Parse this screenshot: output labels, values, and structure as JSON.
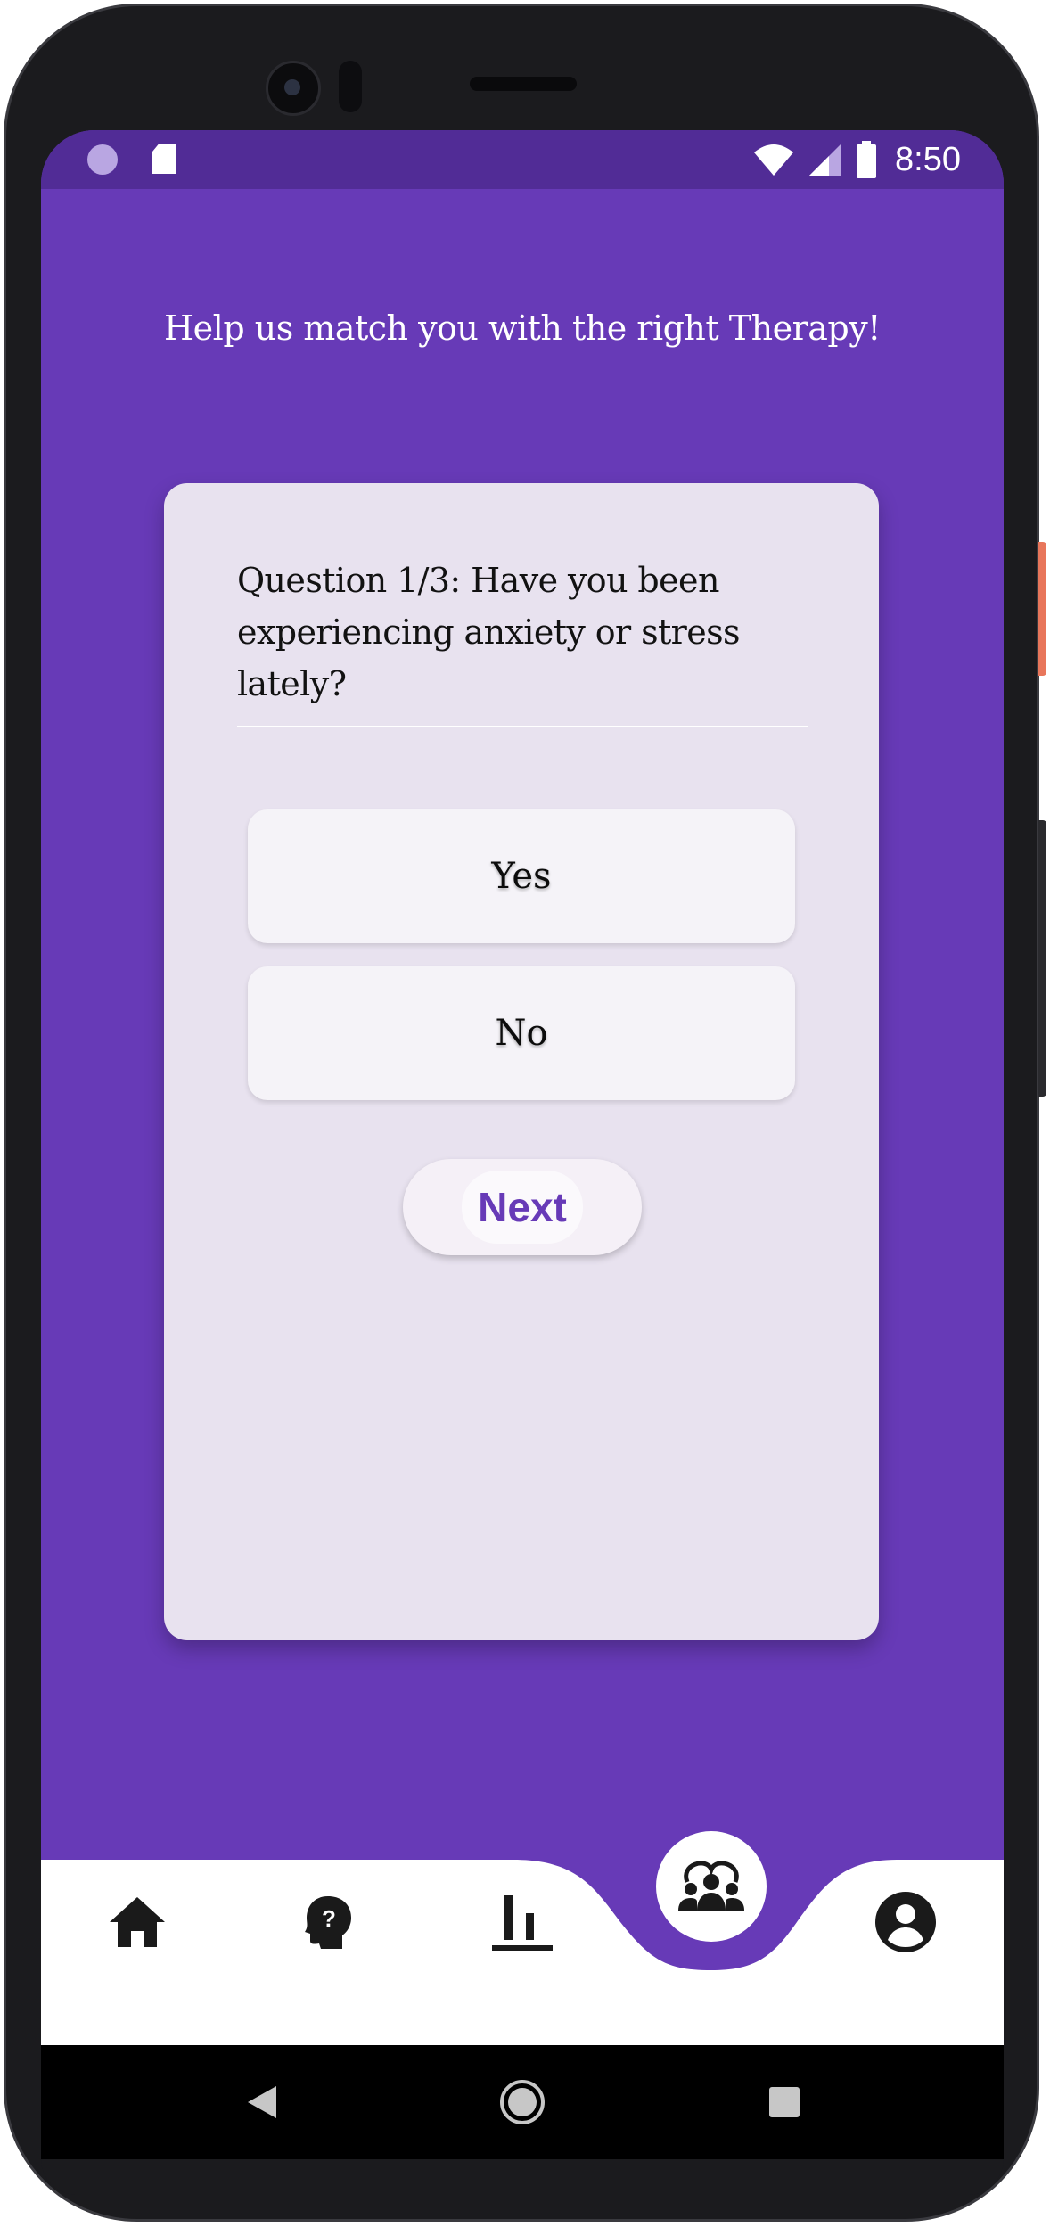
{
  "status_bar": {
    "time": "8:50"
  },
  "header": {
    "title": "Help us match you with the right Therapy!"
  },
  "quiz": {
    "question": "Question 1/3: Have you been experiencing anxiety or stress lately?",
    "options": [
      {
        "label": "Yes"
      },
      {
        "label": "No"
      }
    ],
    "next_label": "Next"
  },
  "bottom_nav": {
    "items": [
      {
        "icon": "home-icon"
      },
      {
        "icon": "help-head-icon"
      },
      {
        "icon": "bar-chart-icon"
      },
      {
        "icon": "group-icon",
        "selected": true
      },
      {
        "icon": "account-circle-icon"
      }
    ]
  },
  "colors": {
    "primary": "#673ab7",
    "status_bar": "#512c96",
    "card": "#e8e2ef"
  }
}
